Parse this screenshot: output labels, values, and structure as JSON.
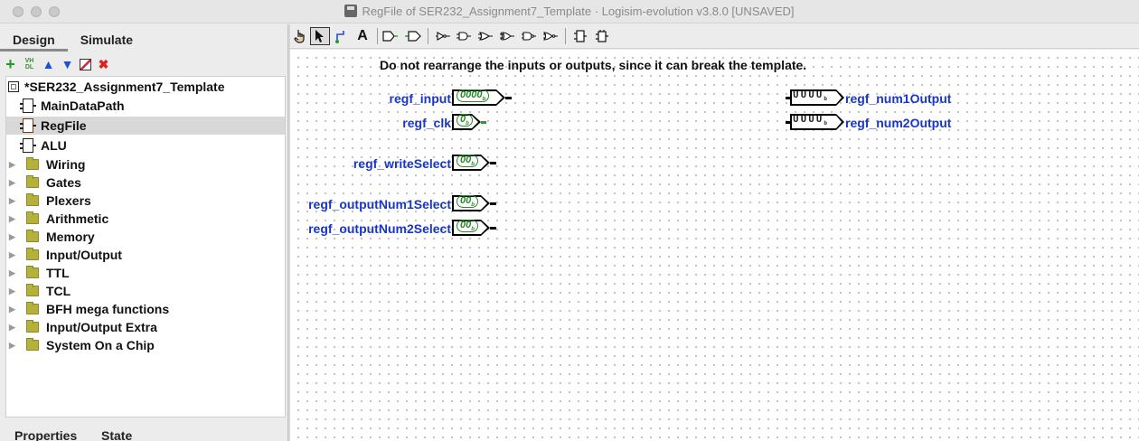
{
  "window": {
    "title": "RegFile of SER232_Assignment7_Template · Logisim-evolution v3.8.0 [UNSAVED]"
  },
  "left_panel": {
    "tabs": [
      "Design",
      "Simulate"
    ],
    "active_tab": "Design",
    "toolbar": {
      "add_icon": "plus-icon",
      "vhdl_label_top": "VH",
      "vhdl_label_bottom": "DL",
      "up_icon": "arrow-up-icon",
      "down_icon": "arrow-down-icon",
      "edit_icon": "edit-appearance-icon",
      "delete_icon": "delete-icon"
    },
    "tree": {
      "project": "*SER232_Assignment7_Template",
      "circuits": [
        {
          "label": "MainDataPath",
          "selected": false
        },
        {
          "label": "RegFile",
          "selected": true
        },
        {
          "label": "ALU",
          "selected": false
        }
      ],
      "libraries": [
        "Wiring",
        "Gates",
        "Plexers",
        "Arithmetic",
        "Memory",
        "Input/Output",
        "TTL",
        "TCL",
        "BFH mega functions",
        "Input/Output Extra",
        "System On a Chip"
      ]
    },
    "bottom_tabs": [
      "Properties",
      "State"
    ]
  },
  "toolbar": {
    "text_tool_label": "A",
    "selected_tool": "select-tool"
  },
  "canvas": {
    "note": "Do not rearrange the inputs or outputs, since it can break the template.",
    "inputs": [
      {
        "label": "regf_input",
        "value": "0000",
        "radix": "b"
      },
      {
        "label": "regf_clk",
        "value": "0",
        "radix": "b"
      },
      {
        "label": "regf_writeSelect",
        "value": "00",
        "radix": "b"
      },
      {
        "label": "regf_outputNum1Select",
        "value": "00",
        "radix": "b"
      },
      {
        "label": "regf_outputNum2Select",
        "value": "00",
        "radix": "b"
      }
    ],
    "outputs": [
      {
        "label": "regf_num1Output",
        "value": "UUUU",
        "radix": "b"
      },
      {
        "label": "regf_num2Output",
        "value": "UUUU",
        "radix": "b"
      }
    ]
  },
  "colors": {
    "pin_label": "#1836c8",
    "pin_value_green": "#2a8a2a",
    "folder": "#b5b13a",
    "selected_row": "#d8d8d8"
  }
}
